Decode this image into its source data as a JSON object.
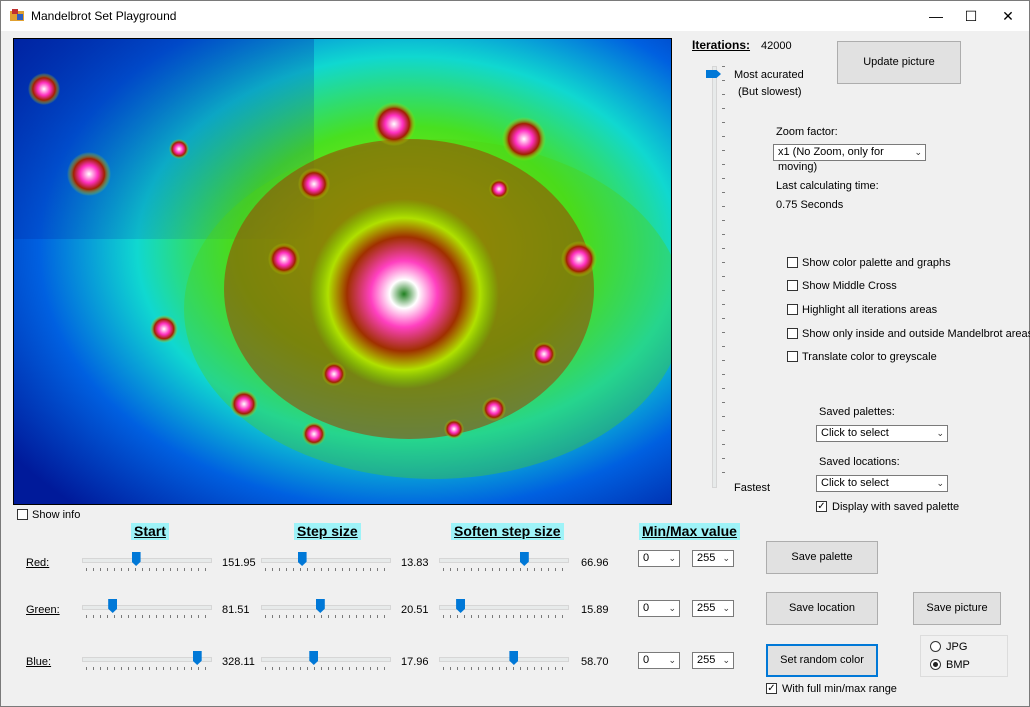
{
  "window": {
    "title": "Mandelbrot Set Playground",
    "minimize": "—",
    "maximize": "☐",
    "close": "✕"
  },
  "iterations": {
    "label": "Iterations:",
    "value": "42000",
    "most_label": "Most acurated",
    "most_sub": "(But slowest)",
    "fastest_label": "Fastest",
    "slider_position": 0.0
  },
  "buttons": {
    "update_picture": "Update picture",
    "save_palette": "Save  palette",
    "save_location": "Save location",
    "save_picture": "Save picture",
    "set_random_color": "Set random color"
  },
  "zoom": {
    "label": "Zoom factor:",
    "value": "x1 (No Zoom, only for moving)"
  },
  "calc_time": {
    "label": "Last calculating time:",
    "value": "0.75 Seconds"
  },
  "options": [
    {
      "label": "Show color palette and graphs",
      "checked": false
    },
    {
      "label": "Show Middle Cross",
      "checked": false
    },
    {
      "label": "Highlight all iterations areas",
      "checked": false
    },
    {
      "label": "Show only inside and outside Mandelbrot areas",
      "checked": false
    },
    {
      "label": "Translate color to greyscale",
      "checked": false
    }
  ],
  "saved_palettes": {
    "label": "Saved palettes:",
    "value": "Click to select"
  },
  "saved_locations": {
    "label": "Saved locations:",
    "value": "Click to select"
  },
  "display_saved_palette": {
    "label": "Display with saved palette",
    "checked": true
  },
  "show_info": {
    "label": "Show info",
    "checked": false
  },
  "columns": {
    "start": "Start",
    "step": "Step size",
    "soften": "Soften step size",
    "minmax": "Min/Max value"
  },
  "rows": [
    {
      "label": "Red:",
      "start": {
        "value": "151.95",
        "pos": 0.42
      },
      "step": {
        "value": "13.83",
        "pos": 0.32
      },
      "soften": {
        "value": "66.96",
        "pos": 0.66
      },
      "min": "0",
      "max": "255"
    },
    {
      "label": "Green:",
      "start": {
        "value": "81.51",
        "pos": 0.24
      },
      "step": {
        "value": "20.51",
        "pos": 0.46
      },
      "soften": {
        "value": "15.89",
        "pos": 0.17
      },
      "min": "0",
      "max": "255"
    },
    {
      "label": "Blue:",
      "start": {
        "value": "328.11",
        "pos": 0.89
      },
      "step": {
        "value": "17.96",
        "pos": 0.41
      },
      "soften": {
        "value": "58.70",
        "pos": 0.58
      },
      "min": "0",
      "max": "255"
    }
  ],
  "full_range": {
    "label": "With full min/max range",
    "checked": true
  },
  "format": {
    "jpg": "JPG",
    "bmp": "BMP",
    "selected": "BMP"
  }
}
